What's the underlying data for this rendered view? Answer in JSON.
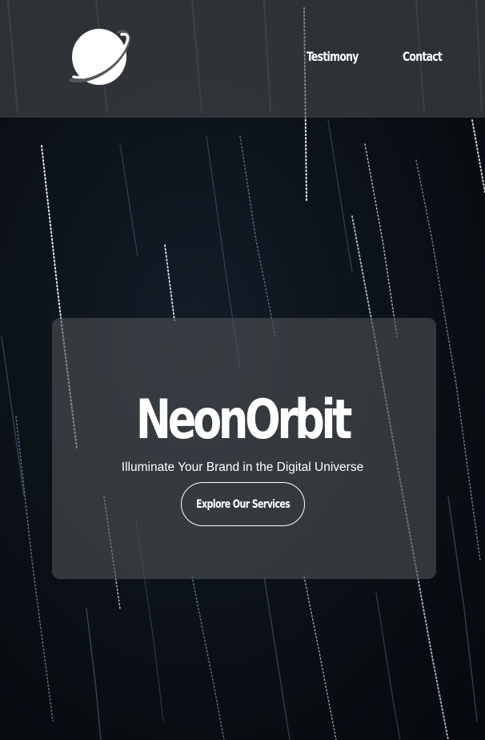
{
  "header": {
    "logo_icon": "planet-logo-icon",
    "nav": {
      "testimony_label": "Testimony",
      "contact_label": "Contact"
    }
  },
  "hero": {
    "title": "NeonOrbit",
    "subtitle": "Illuminate Your Brand in the Digital Universe",
    "cta_label": "Explore Our Services"
  },
  "colors": {
    "background": "#0b1016",
    "header_overlay": "#46484c",
    "card_overlay": "#4e5054",
    "text": "#ffffff"
  }
}
